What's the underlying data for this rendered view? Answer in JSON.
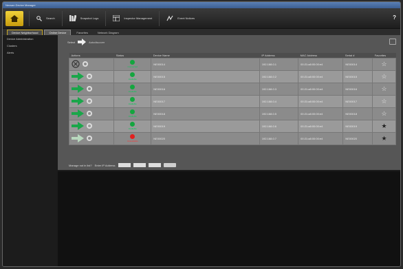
{
  "window": {
    "title": "Nexsan Device Manager"
  },
  "toolbar": {
    "items": [
      {
        "label": "Home"
      },
      {
        "label": "Search"
      },
      {
        "label": "Snapshot Logs"
      },
      {
        "label": "Inspector Management"
      },
      {
        "label": "Event Notices"
      }
    ],
    "help": "?"
  },
  "tabs": [
    "Device Neighborhood",
    "Online Device",
    "Favorites",
    "Network Diagram"
  ],
  "sidebar": {
    "items": [
      "Device Administration",
      "Clusters",
      "Alerts"
    ]
  },
  "filter": {
    "label": "Select",
    "hint": "Autodiscover"
  },
  "table": {
    "columns": [
      "Actions",
      "Status",
      "Device Name",
      "IP Address",
      "MAC Address",
      "Serial #",
      "Favorites"
    ],
    "rows": [
      {
        "status": "Connected",
        "name": "NE00014",
        "ip": "192.168.0.1",
        "mac": "00:21:a8:00:00:e4",
        "serial": "NE00014",
        "fav": "empty",
        "action": "unavailable"
      },
      {
        "status": "Available",
        "name": "NE00015",
        "ip": "192.168.0.2",
        "mac": "00:21:a8:00:00:e4",
        "serial": "NE00015",
        "fav": "empty",
        "action": "connect"
      },
      {
        "status": "Available",
        "name": "NE00016",
        "ip": "192.168.0.3",
        "mac": "00:21:a8:00:00:e4",
        "serial": "NE00016",
        "fav": "empty",
        "action": "connect"
      },
      {
        "status": "Available",
        "name": "NE00017",
        "ip": "192.168.0.4",
        "mac": "00:21:a8:00:00:e4",
        "serial": "NE00017",
        "fav": "empty",
        "action": "connect"
      },
      {
        "status": "Available",
        "name": "NE00018",
        "ip": "192.168.0.5",
        "mac": "00:21:a8:00:00:e4",
        "serial": "NE00018",
        "fav": "empty",
        "action": "connect"
      },
      {
        "status": "Available",
        "name": "NE00019",
        "ip": "192.168.0.6",
        "mac": "00:21:a8:00:00:e4",
        "serial": "NE00019",
        "fav": "filled",
        "action": "connect"
      },
      {
        "status": "Unavailable",
        "name": "NE00020",
        "ip": "192.168.0.7",
        "mac": "00:21:a8:00:00:e4",
        "serial": "NE00020",
        "fav": "filled",
        "action": "disabled"
      }
    ]
  },
  "footer": {
    "prompt": "Manage not in list?",
    "label": "Enter IP Address"
  },
  "colors": {
    "accent": "#c9a823",
    "ok": "#14a63f",
    "err": "#e21f1f",
    "arrow": "#1aa64a"
  }
}
